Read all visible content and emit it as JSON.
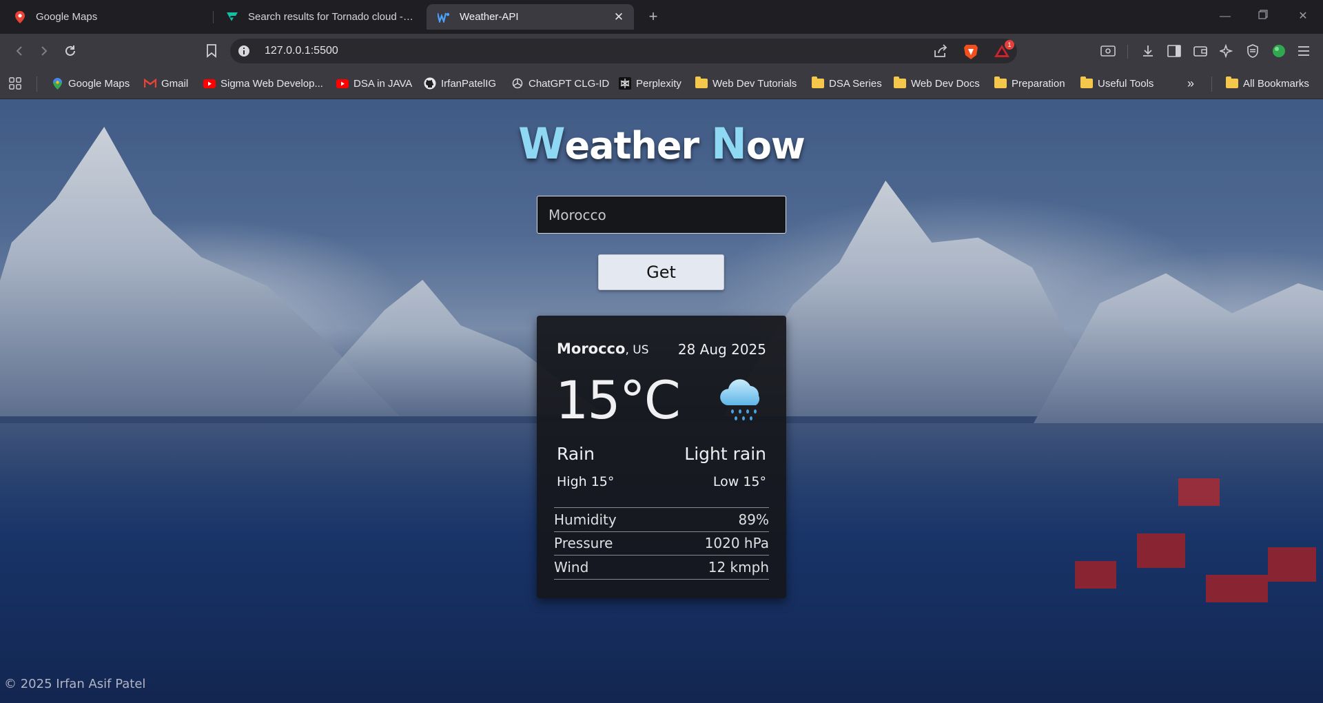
{
  "browser": {
    "tabs": [
      {
        "title": "Google Maps",
        "icon": "google-maps-icon"
      },
      {
        "title": "Search results for Tornado cloud - Fla",
        "icon": "flaticon-icon"
      },
      {
        "title": "Weather-API",
        "icon": "weather-api-icon",
        "active": true
      }
    ],
    "url": "127.0.0.1:5500",
    "notification_count": "1",
    "bookmarks": [
      {
        "label": "Google Maps",
        "icon": "google-maps-icon"
      },
      {
        "label": "Gmail",
        "icon": "gmail-icon"
      },
      {
        "label": "Sigma Web Develop...",
        "icon": "youtube-icon"
      },
      {
        "label": "DSA in JAVA",
        "icon": "youtube-icon"
      },
      {
        "label": "IrfanPatelIG",
        "icon": "github-icon"
      },
      {
        "label": "ChatGPT CLG-ID",
        "icon": "chatgpt-icon"
      },
      {
        "label": "Perplexity",
        "icon": "perplexity-icon"
      },
      {
        "label": "Web Dev Tutorials",
        "icon": "folder-icon"
      },
      {
        "label": "DSA Series",
        "icon": "folder-icon"
      },
      {
        "label": "Web Dev Docs",
        "icon": "folder-icon"
      },
      {
        "label": "Preparation",
        "icon": "folder-icon"
      },
      {
        "label": "Useful Tools",
        "icon": "folder-icon"
      },
      {
        "label": "All Bookmarks",
        "icon": "folder-icon"
      }
    ]
  },
  "app": {
    "title_cap1": "W",
    "title_rest1": "eather",
    "title_cap2": "N",
    "title_rest2": "ow",
    "search_value": "Morocco",
    "get_label": "Get",
    "card": {
      "city": "Morocco",
      "country": ", US",
      "date": "28 Aug 2025",
      "temperature": "15°C",
      "condition": "Rain",
      "description": "Light rain",
      "high": "High 15°",
      "low": "Low 15°",
      "weather_icon": "rain-cloud-icon",
      "stats": [
        {
          "label": "Humidity",
          "value": "89%"
        },
        {
          "label": "Pressure",
          "value": "1020 hPa"
        },
        {
          "label": "Wind",
          "value": "12 kmph"
        }
      ]
    },
    "footer": "© 2025 Irfan Asif Patel",
    "colors": {
      "title_accent": "#8fd8f3",
      "card_bg": "#16171b",
      "button_bg": "#e4e9f1"
    }
  }
}
